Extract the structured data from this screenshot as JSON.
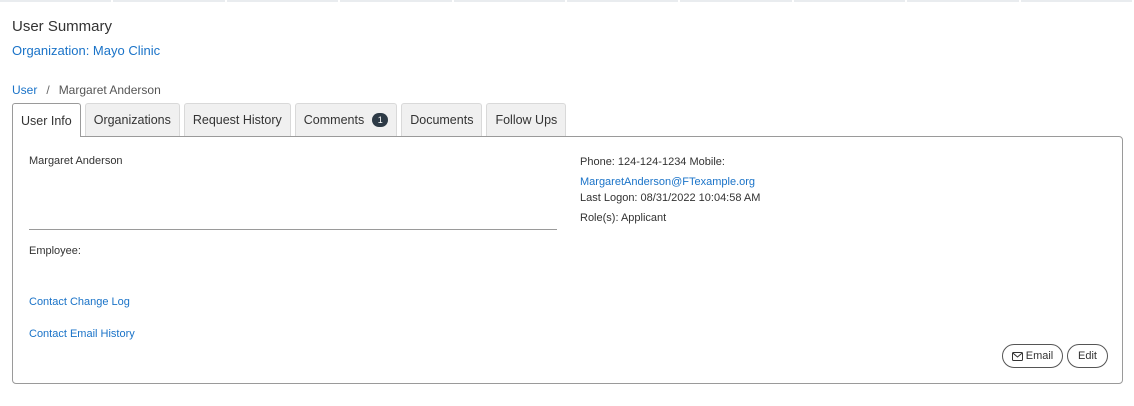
{
  "page": {
    "title": "User Summary",
    "organization": "Organization: Mayo Clinic"
  },
  "breadcrumb": {
    "parent": "User",
    "separator": "/",
    "current": "Margaret Anderson"
  },
  "tabs": [
    {
      "label": "User Info",
      "active": true
    },
    {
      "label": "Organizations"
    },
    {
      "label": "Request History"
    },
    {
      "label": "Comments",
      "badge": "1"
    },
    {
      "label": "Documents"
    },
    {
      "label": "Follow Ups"
    }
  ],
  "user_info": {
    "name": "Margaret Anderson",
    "employee_label": "Employee:",
    "phone_line": "Phone: 124-124-1234 Mobile:",
    "email": "MargaretAnderson@FTexample.org",
    "last_logon": "Last Logon: 08/31/2022 10:04:58 AM",
    "roles": "Role(s): Applicant",
    "links": {
      "change_log": "Contact Change Log",
      "email_history": "Contact Email History"
    },
    "buttons": {
      "email": "Email",
      "edit": "Edit"
    }
  },
  "icons": {
    "email_button_icon": "envelope-icon"
  },
  "colors": {
    "link": "#1a73c8",
    "badge_bg": "#2d3a46",
    "border": "#9a9a9a"
  }
}
